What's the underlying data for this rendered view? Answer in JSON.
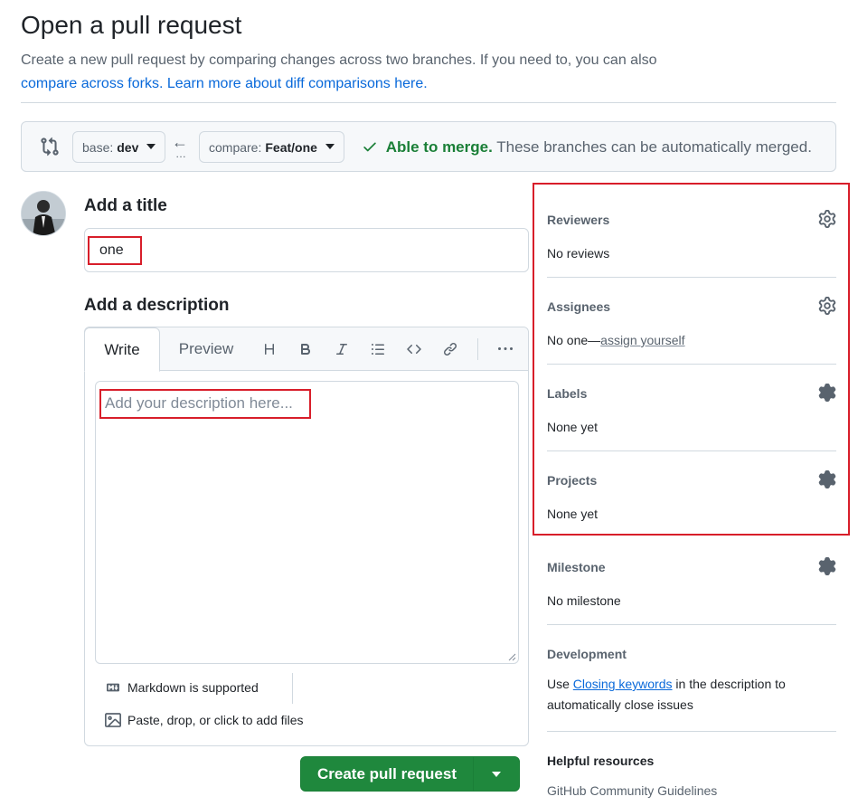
{
  "header": {
    "title": "Open a pull request",
    "subtitle_text": "Create a new pull request by comparing changes across two branches. If you need to, you can also",
    "compare_forks_link": "compare across forks.",
    "learn_more_link": "Learn more about diff comparisons here."
  },
  "compare": {
    "base_prefix": "base:",
    "base_branch": "dev",
    "compare_prefix": "compare:",
    "compare_branch": "Feat/one",
    "arrow_glyph": "←",
    "dots_glyph": "…",
    "merge_status": "Able to merge.",
    "merge_detail": "These branches can be automatically merged."
  },
  "form": {
    "title_label": "Add a title",
    "title_value": "one",
    "description_label": "Add a description",
    "tabs": [
      {
        "label": "Write",
        "active": true
      },
      {
        "label": "Preview",
        "active": false
      }
    ],
    "toolbar": [
      "heading-icon",
      "bold-icon",
      "italic-icon",
      "list-icon",
      "code-icon",
      "link-icon",
      "more-icon"
    ],
    "description_placeholder": "Add your description here...",
    "markdown_note": "Markdown is supported",
    "attach_note": "Paste, drop, or click to add files",
    "create_button": "Create pull request"
  },
  "sidebar": {
    "reviewers": {
      "heading": "Reviewers",
      "value": "No reviews"
    },
    "assignees": {
      "heading": "Assignees",
      "value_prefix": "No one—",
      "value_link": "assign yourself"
    },
    "labels": {
      "heading": "Labels",
      "value": "None yet"
    },
    "projects": {
      "heading": "Projects",
      "value": "None yet"
    },
    "milestone": {
      "heading": "Milestone",
      "value": "No milestone"
    },
    "development": {
      "heading": "Development",
      "prefix": "Use ",
      "link": "Closing keywords",
      "suffix": " in the description to automatically close issues"
    },
    "helpful": {
      "heading": "Helpful resources",
      "link": "GitHub Community Guidelines"
    }
  },
  "colors": {
    "accent_green": "#1f883d",
    "merge_green": "#1a7f37",
    "link_blue": "#0969da",
    "highlight_red": "#d81e2a"
  }
}
